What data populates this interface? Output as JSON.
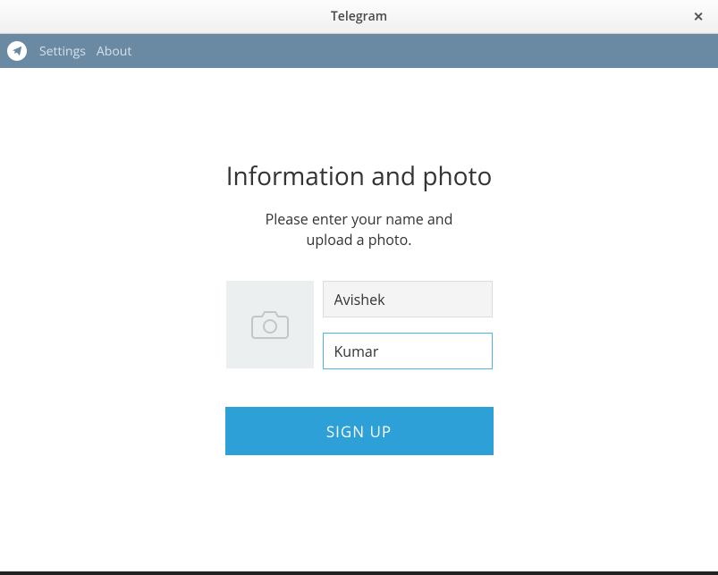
{
  "window": {
    "title": "Telegram"
  },
  "menubar": {
    "settings_label": "Settings",
    "about_label": "About"
  },
  "main": {
    "heading": "Information and photo",
    "subtext_line1": "Please enter your name and",
    "subtext_line2": "upload a photo."
  },
  "form": {
    "first_name_value": "Avishek",
    "last_name_value": "Kumar",
    "signup_label": "SIGN UP"
  }
}
